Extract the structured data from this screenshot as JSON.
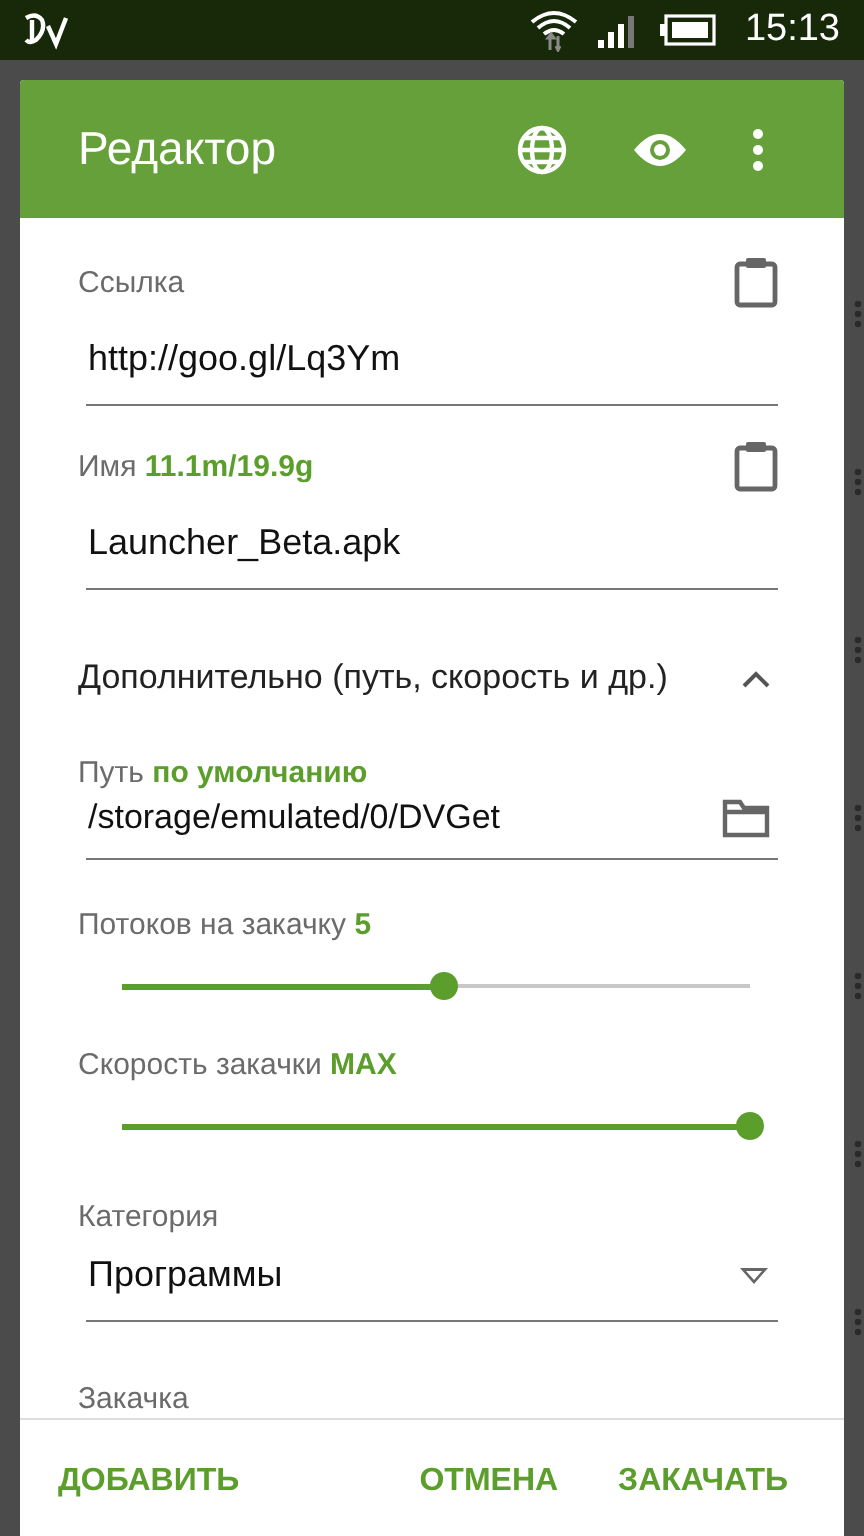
{
  "status_bar": {
    "time": "15:13"
  },
  "dialog": {
    "title": "Редактор",
    "sections": [
      {
        "kind": "paste_field",
        "label": "Ссылка",
        "value": "http://goo.gl/Lq3Ym"
      },
      {
        "kind": "paste_field",
        "label": "Имя",
        "label_value": "11.1m/19.9g",
        "value": "Launcher_Beta.apk"
      },
      {
        "kind": "expander",
        "label": "Дополнительно (путь, скорость и др.)",
        "expanded": true
      },
      {
        "kind": "folder_field",
        "label": "Путь",
        "label_value": "по умолчанию",
        "value": "/storage/emulated/0/DVGet"
      },
      {
        "kind": "slider",
        "label": "Потоков на закачку",
        "label_value": "5",
        "level": 0.5
      },
      {
        "kind": "slider",
        "label": "Скорость закачки",
        "label_value": "MAX",
        "level": 1
      },
      {
        "kind": "dropdown",
        "label": "Категория",
        "value": "Программы"
      },
      {
        "kind": "heading",
        "label": "Закачка"
      }
    ],
    "buttons": [
      {
        "label": "ДОБАВИТЬ"
      },
      {
        "label": "ОТМЕНА"
      },
      {
        "label": "ЗАКАЧАТЬ"
      }
    ]
  }
}
